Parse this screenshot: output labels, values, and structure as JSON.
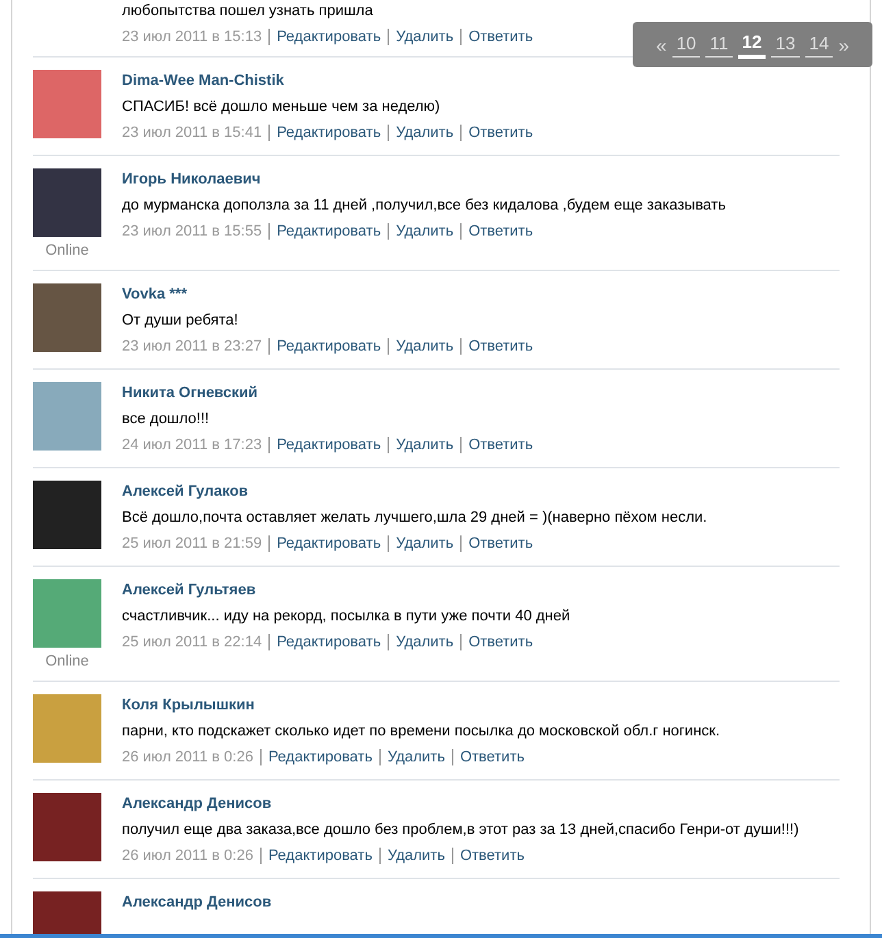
{
  "pagination": {
    "prev": "«",
    "next": "»",
    "pages": [
      {
        "label": "10",
        "selected": false
      },
      {
        "label": "11",
        "selected": false
      },
      {
        "label": "12",
        "selected": true
      },
      {
        "label": "13",
        "selected": false
      },
      {
        "label": "14",
        "selected": false
      }
    ]
  },
  "comments": [
    {
      "text": "любопытства пошел узнать пришла",
      "date": "23 июл 2011 в 15:13",
      "actions": [
        "Редактировать",
        "Удалить",
        "Ответить"
      ]
    },
    {
      "name": "Dima-Wee Man-Chistik",
      "text": "СПАСИБ! всё дошло меньше чем за неделю)",
      "date": "23 июл 2011 в 15:41",
      "actions": [
        "Редактировать",
        "Удалить",
        "Ответить"
      ]
    },
    {
      "name": "Игорь Николаевич",
      "text": "до мурманска доползла за 11 дней ,получил,все без кидалова ,будем еще заказывать",
      "date": "23 июл 2011 в 15:55",
      "actions": [
        "Редактировать",
        "Удалить",
        "Ответить"
      ],
      "status": "Online"
    },
    {
      "name": "Vovka ***",
      "text": "От души ребята!",
      "date": "23 июл 2011 в 23:27",
      "actions": [
        "Редактировать",
        "Удалить",
        "Ответить"
      ]
    },
    {
      "name": "Никита Огневский",
      "text": "все дошло!!!",
      "date": "24 июл 2011 в 17:23",
      "actions": [
        "Редактировать",
        "Удалить",
        "Ответить"
      ]
    },
    {
      "name": "Алексей Гулаков",
      "text": "Всё дошло,почта оставляет желать лучшего,шла 29 дней = )(наверно пёхом несли.",
      "date": "25 июл 2011 в 21:59",
      "actions": [
        "Редактировать",
        "Удалить",
        "Ответить"
      ]
    },
    {
      "name": "Алексей Гультяев",
      "text": "счастливчик... иду на рекорд, посылка в пути уже почти 40 дней",
      "date": "25 июл 2011 в 22:14",
      "actions": [
        "Редактировать",
        "Удалить",
        "Ответить"
      ],
      "status": "Online"
    },
    {
      "name": "Коля Крылышкин",
      "text": "парни, кто подскажет сколько идет по времени посылка до московской обл.г ногинск.",
      "date": "26 июл 2011 в 0:26",
      "actions": [
        "Редактировать",
        "Удалить",
        "Ответить"
      ]
    },
    {
      "name": "Александр Денисов",
      "text": "получил еще два заказа,все дошло без проблем,в этот раз за 13 дней,спасибо Генри-от души!!!)",
      "date": "26 июл 2011 в 0:26",
      "actions": [
        "Редактировать",
        "Удалить",
        "Ответить"
      ]
    },
    {
      "name": "Александр Денисов"
    }
  ]
}
